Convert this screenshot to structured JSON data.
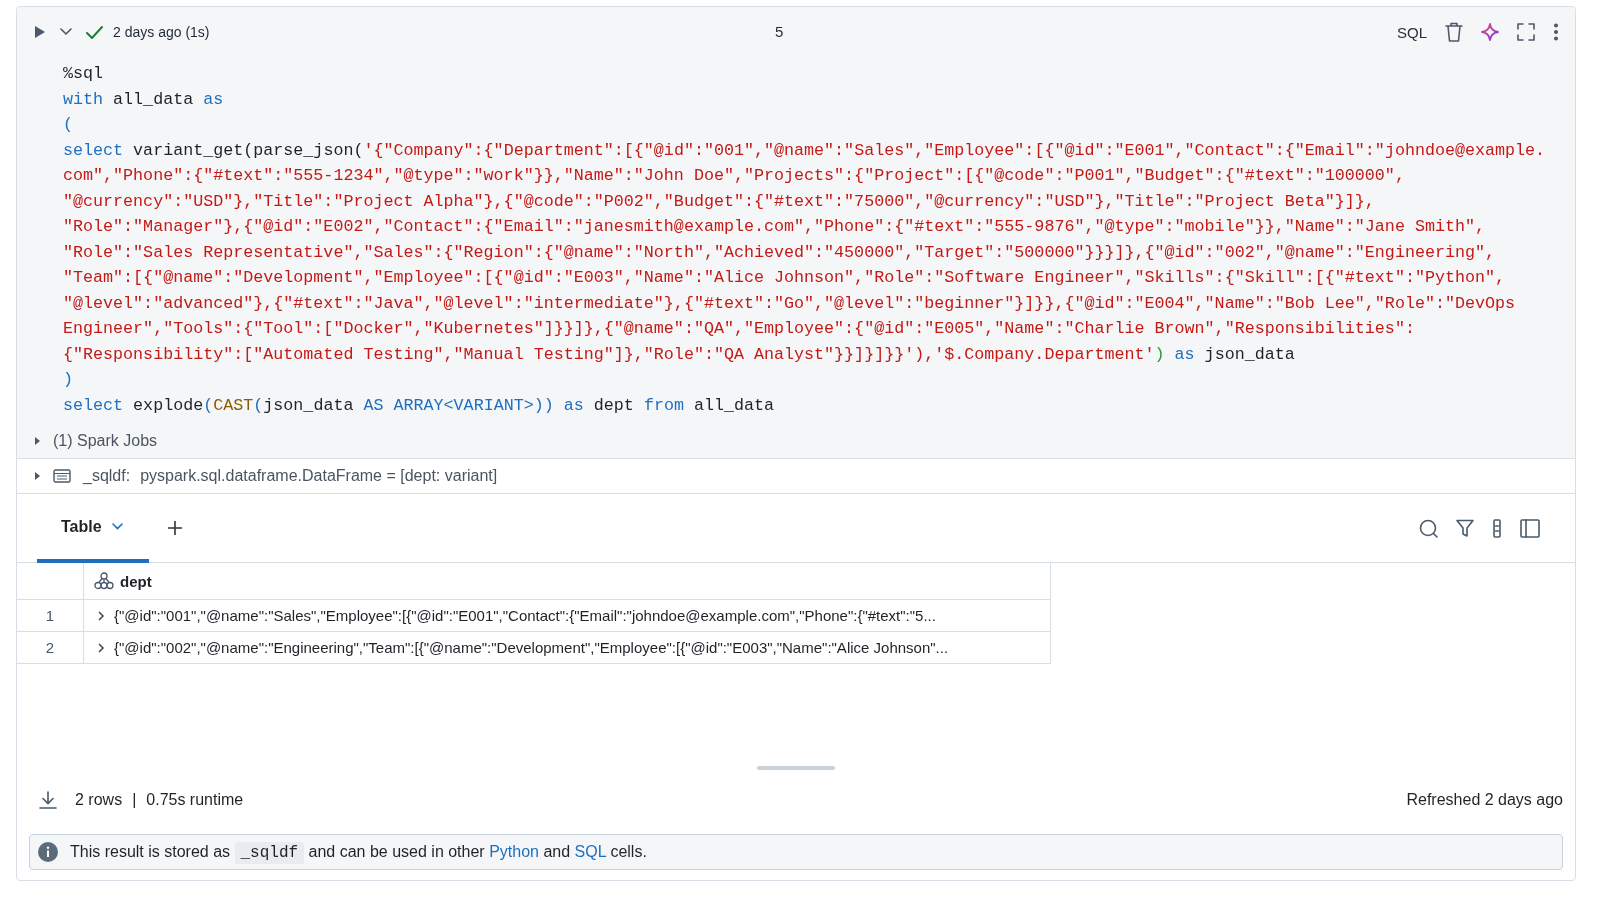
{
  "cell": {
    "status_text": "2 days ago (1s)",
    "cell_number": "5",
    "language": "SQL"
  },
  "code": [
    [
      {
        "kind": "plain",
        "text": "%sql"
      }
    ],
    [
      {
        "kind": "keyword",
        "text": "with"
      },
      {
        "kind": "plain",
        "text": " all_data "
      },
      {
        "kind": "keyword",
        "text": "as"
      }
    ],
    [
      {
        "kind": "bracket",
        "text": "("
      }
    ],
    [
      {
        "kind": "keyword",
        "text": "select"
      },
      {
        "kind": "plain",
        "text": " variant_get(parse_json("
      },
      {
        "kind": "string",
        "text": "'{\"Company\":{\"Department\":[{\"@id\":\"001\",\"@name\":\"Sales\",\"Employee\":[{\"@id\":\"E001\",\"Contact\":{\"Email\":\"johndoe@example."
      }
    ],
    [
      {
        "kind": "string",
        "text": "com\",\"Phone\":{\"#text\":\"555-1234\",\"@type\":\"work\"}},\"Name\":\"John Doe\",\"Projects\":{\"Project\":[{\"@code\":\"P001\",\"Budget\":{\"#text\":\"100000\","
      }
    ],
    [
      {
        "kind": "string",
        "text": "\"@currency\":\"USD\"},\"Title\":\"Project Alpha\"},{\"@code\":\"P002\",\"Budget\":{\"#text\":\"75000\",\"@currency\":\"USD\"},\"Title\":\"Project Beta\"}]},"
      }
    ],
    [
      {
        "kind": "string",
        "text": "\"Role\":\"Manager\"},{\"@id\":\"E002\",\"Contact\":{\"Email\":\"janesmith@example.com\",\"Phone\":{\"#text\":\"555-9876\",\"@type\":\"mobile\"}},\"Name\":\"Jane Smith\","
      }
    ],
    [
      {
        "kind": "string",
        "text": "\"Role\":\"Sales Representative\",\"Sales\":{\"Region\":{\"@name\":\"North\",\"Achieved\":\"450000\",\"Target\":\"500000\"}}}]},{\"@id\":\"002\",\"@name\":\"Engineering\","
      }
    ],
    [
      {
        "kind": "string",
        "text": "\"Team\":[{\"@name\":\"Development\",\"Employee\":[{\"@id\":\"E003\",\"Name\":\"Alice Johnson\",\"Role\":\"Software Engineer\",\"Skills\":{\"Skill\":[{\"#text\":\"Python\","
      }
    ],
    [
      {
        "kind": "string",
        "text": "\"@level\":\"advanced\"},{\"#text\":\"Java\",\"@level\":\"intermediate\"},{\"#text\":\"Go\",\"@level\":\"beginner\"}]}},{\"@id\":\"E004\",\"Name\":\"Bob Lee\",\"Role\":\"DevOps"
      }
    ],
    [
      {
        "kind": "string",
        "text": "Engineer\",\"Tools\":{\"Tool\":[\"Docker\",\"Kubernetes\"]}}]},{\"@name\":\"QA\",\"Employee\":{\"@id\":\"E005\",\"Name\":\"Charlie Brown\",\"Responsibilities\":"
      }
    ],
    [
      {
        "kind": "string",
        "text": "{\"Responsibility\":[\"Automated Testing\",\"Manual Testing\"]},\"Role\":\"QA Analyst\"}}]}]}}'"
      },
      {
        "kind": "string",
        "text": "),'$.Company.Department'"
      },
      {
        "kind": "match",
        "text": ")"
      },
      {
        "kind": "keyword",
        "text": " as"
      },
      {
        "kind": "plain",
        "text": " json_data"
      }
    ],
    [
      {
        "kind": "bracket",
        "text": ")"
      }
    ],
    [
      {
        "kind": "keyword",
        "text": "select"
      },
      {
        "kind": "plain",
        "text": " explode"
      },
      {
        "kind": "bracket",
        "text": "("
      },
      {
        "kind": "builtin",
        "text": "CAST"
      },
      {
        "kind": "bracket",
        "text": "("
      },
      {
        "kind": "plain",
        "text": "json_data "
      },
      {
        "kind": "keyword",
        "text": "AS ARRAY"
      },
      {
        "kind": "bracket",
        "text": "<"
      },
      {
        "kind": "keyword",
        "text": "VARIANT"
      },
      {
        "kind": "bracket",
        "text": ">))"
      },
      {
        "kind": "keyword",
        "text": " as"
      },
      {
        "kind": "plain",
        "text": " dept "
      },
      {
        "kind": "keyword",
        "text": "from"
      },
      {
        "kind": "plain",
        "text": " all_data"
      }
    ]
  ],
  "spark_jobs": {
    "label": "(1) Spark Jobs",
    "expanded": false
  },
  "dataframe": {
    "name": "_sqldf:",
    "schema": "pyspark.sql.dataframe.DataFrame = [dept: variant]",
    "expanded": false
  },
  "result_tabs": [
    {
      "label": "Table",
      "selected": true
    }
  ],
  "table": {
    "columns": [
      {
        "label": "dept"
      }
    ],
    "rows": [
      {
        "index": "1",
        "value": "{\"@id\":\"001\",\"@name\":\"Sales\",\"Employee\":[{\"@id\":\"E001\",\"Contact\":{\"Email\":\"johndoe@example.com\",\"Phone\":{\"#text\":\"5...",
        "expanded": false
      },
      {
        "index": "2",
        "value": "{\"@id\":\"002\",\"@name\":\"Engineering\",\"Team\":[{\"@name\":\"Development\",\"Employee\":[{\"@id\":\"E003\",\"Name\":\"Alice Johnson\"...",
        "expanded": false
      }
    ]
  },
  "footer": {
    "row_count": "2 rows",
    "separator": "|",
    "runtime": "0.75s runtime",
    "refreshed": "Refreshed 2 days ago"
  },
  "notice": [
    {
      "kind": "text",
      "text": "This result is stored as "
    },
    {
      "kind": "code",
      "text": "_sqldf"
    },
    {
      "kind": "text",
      "text": " and can be used in other "
    },
    {
      "kind": "link",
      "text": "Python"
    },
    {
      "kind": "text",
      "text": " and "
    },
    {
      "kind": "link",
      "text": "SQL"
    },
    {
      "kind": "text",
      "text": " cells."
    }
  ]
}
